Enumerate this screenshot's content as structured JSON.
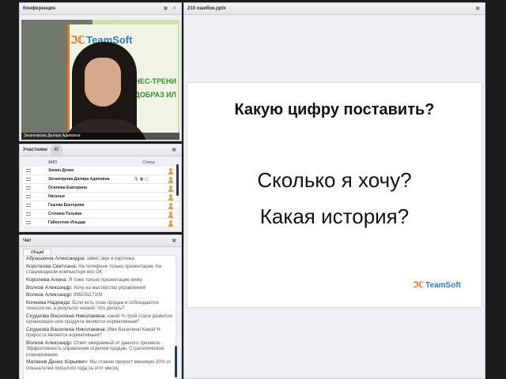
{
  "conference": {
    "title": "Конференция",
    "tools": "▣ ✕",
    "speaker_name": "Зигангирова Диляра Адиповна",
    "logo_text": "TeamSoft",
    "banner_text": "НЕС-ТРЕНИ ДОБРАЗ ИЛ"
  },
  "participants": {
    "title": "Участники",
    "count": "45",
    "col_name": "ФИО",
    "col_status": "Статус",
    "list": [
      {
        "name": "Зимин Денис",
        "status": ""
      },
      {
        "name": "Зигангирова Диляра Адиповна",
        "status": "🎙 ▣ ▢"
      },
      {
        "name": "Осипова Екатерина",
        "status": ""
      },
      {
        "name": "Наталья",
        "status": ""
      },
      {
        "name": "Гашева Екатерина",
        "status": ""
      },
      {
        "name": "Стенина Татьяна",
        "status": ""
      },
      {
        "name": "Гайнуллин Ильдар",
        "status": ""
      }
    ]
  },
  "chat": {
    "title": "Чат",
    "tab": "Общий",
    "messages": [
      {
        "from": "Абрашкина Александра:",
        "text": "завис звук и картинка"
      },
      {
        "from": "Короткова Светлана:",
        "text": "На телефоне только презентация. На стационарном компьютере все ОК"
      },
      {
        "from": "Королева Алена:",
        "text": "Я тоже только презентацию вижу"
      },
      {
        "from": "Волков Александр:",
        "text": "Хочу на мастерство управления!"
      },
      {
        "from": "Волков Александр:",
        "text": "89503117109"
      },
      {
        "from": "Кочнева Надежда:",
        "text": "Если есть план продаж и соблюдаются технологии, а результат низкий. Что делать?"
      },
      {
        "from": "Скуднова Василина Николаевна:",
        "text": "какой % прой стали развития организации или продукта является нормативным?"
      },
      {
        "from": "Скуднова Василина Николаевна:",
        "text": "Имя Василина! Какой % прироста является нормативным?"
      },
      {
        "from": "Волков Александр:",
        "text": "Ответ ожидаемый от данного тренинга - Эффективность управления отделом продаж. Стратегическое планирование."
      },
      {
        "from": "Матвеев Денис Юрьевич:",
        "text": "Мы ставим прирост минимум 20% от показателей прошлого года за этот месяц"
      }
    ]
  },
  "presentation": {
    "file": "210 ошибок.pptx",
    "heading": "Какую цифру поставить?",
    "line1": "Сколько я хочу?",
    "line2": "Какая история?",
    "brand": "TeamSoft",
    "brand_mark": "ℑℂ"
  }
}
